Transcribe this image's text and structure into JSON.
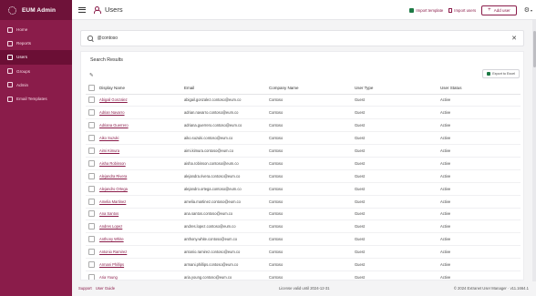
{
  "app": {
    "title": "EUM Admin"
  },
  "sidebar": {
    "items": [
      {
        "label": "Home",
        "icon": "home-icon"
      },
      {
        "label": "Reports",
        "icon": "chart-icon"
      },
      {
        "label": "Users",
        "icon": "users-icon",
        "active": true
      },
      {
        "label": "Groups",
        "icon": "groups-icon"
      },
      {
        "label": "Admin",
        "icon": "gear-icon"
      },
      {
        "label": "Email Templates",
        "icon": "mail-icon"
      }
    ]
  },
  "header": {
    "title": "Users",
    "import_template": "Import template",
    "import_users": "Import users",
    "add_user": "Add user"
  },
  "search": {
    "value": "@contoso"
  },
  "results": {
    "title": "Search Results",
    "export_label": "Export to Excel",
    "columns": [
      "Display Name",
      "Email",
      "Company Name",
      "User Type",
      "User Status"
    ],
    "rows": [
      {
        "name": "Abigail Gonzalez",
        "email": "abigail.gonzalez.contoso@eum.co",
        "company": "Contoso",
        "type": "Guest",
        "status": "Active"
      },
      {
        "name": "Adrian Navarro",
        "email": "adrian.navarro.contoso@eum.co",
        "company": "Contoso",
        "type": "Guest",
        "status": "Active"
      },
      {
        "name": "Adriana Guerrero",
        "email": "adriana.guerrero.contoso@eum.co",
        "company": "Contoso",
        "type": "Guest",
        "status": "Active"
      },
      {
        "name": "Aiko Suzuki",
        "email": "aiko.suzuki.contoso@eum.co",
        "company": "Contoso",
        "type": "Guest",
        "status": "Active"
      },
      {
        "name": "Aimi Kimura",
        "email": "aimi.kimura.contoso@eum.co",
        "company": "Contoso",
        "type": "Guest",
        "status": "Active"
      },
      {
        "name": "Aisha Robinson",
        "email": "aisha.robinson.contoso@eum.co",
        "company": "Contoso",
        "type": "Guest",
        "status": "Active"
      },
      {
        "name": "Alejandra Rivera",
        "email": "alejandra.rivera.contoso@eum.co",
        "company": "Contoso",
        "type": "Guest",
        "status": "Active"
      },
      {
        "name": "Alejandro Ortega",
        "email": "alejandro.ortega.contoso@eum.co",
        "company": "Contoso",
        "type": "Guest",
        "status": "Active"
      },
      {
        "name": "Amelia Martinez",
        "email": "amelia.martinez.contoso@eum.co",
        "company": "Contoso",
        "type": "Guest",
        "status": "Active"
      },
      {
        "name": "Ana Santos",
        "email": "ana.santos.contoso@eum.co",
        "company": "Contoso",
        "type": "Guest",
        "status": "Active"
      },
      {
        "name": "Andres Lopez",
        "email": "andres.lopez.contoso@eum.co",
        "company": "Contoso",
        "type": "Guest",
        "status": "Active"
      },
      {
        "name": "Anthony White",
        "email": "anthony.white.contoso@eum.co",
        "company": "Contoso",
        "type": "Guest",
        "status": "Active"
      },
      {
        "name": "Antonio Ramirez",
        "email": "antonio.ramirez.contoso@eum.co",
        "company": "Contoso",
        "type": "Guest",
        "status": "Active"
      },
      {
        "name": "Armani Phillips",
        "email": "armani.phillips.contoso@eum.co",
        "company": "Contoso",
        "type": "Guest",
        "status": "Active"
      },
      {
        "name": "Aria Young",
        "email": "aria.young.contoso@eum.co",
        "company": "Contoso",
        "type": "Guest",
        "status": "Active"
      }
    ]
  },
  "footer": {
    "support": "Support",
    "user_guide": "User Guide",
    "license": "License valid until 2024-12-31",
    "copyright": "© 2024 Extranet User Manager",
    "version": "v11.1664.1"
  },
  "colors": {
    "brand": "#8a1c4a",
    "brand_dark": "#6b0f35",
    "excel": "#1d7a45"
  }
}
